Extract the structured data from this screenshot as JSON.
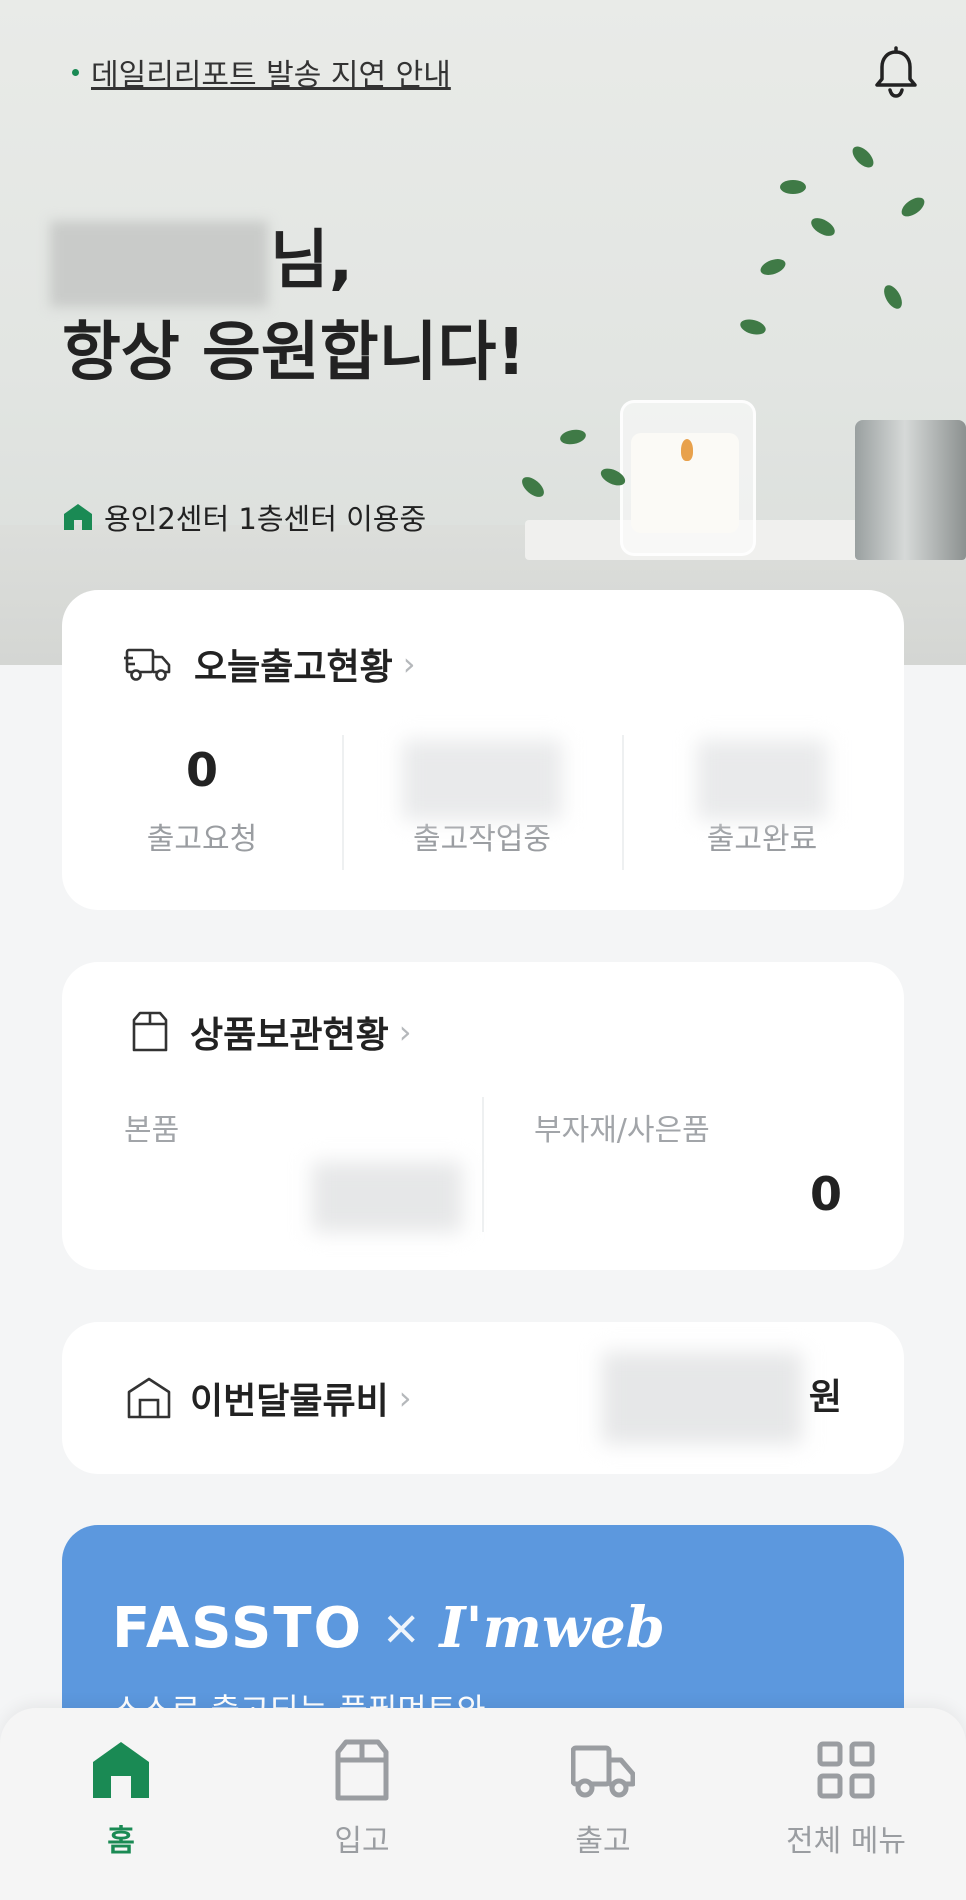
{
  "header": {
    "notice_text": "데일리리포트 발송 지연 안내",
    "greeting_suffix": "님,",
    "greeting_line2": "항상 응원합니다!",
    "center_status": "용인2센터 1층센터 이용중"
  },
  "outbound_card": {
    "title": "오늘출고현황",
    "stats": [
      {
        "label": "출고요청",
        "value": "0"
      },
      {
        "label": "출고작업중",
        "value": ""
      },
      {
        "label": "출고완료",
        "value": ""
      }
    ]
  },
  "storage_card": {
    "title": "상품보관현황",
    "main_label": "본품",
    "main_value": "",
    "sub_label": "부자재/사은품",
    "sub_value": "0"
  },
  "fee_card": {
    "title": "이번달물류비",
    "currency": "원"
  },
  "banner": {
    "brand_left": "FASSTO",
    "separator": "×",
    "brand_right": "I'mweb",
    "subtitle": "스스로 출고되는 풀필먼트와"
  },
  "bottom_nav": {
    "items": [
      {
        "label": "홈",
        "icon": "home-icon",
        "active": true
      },
      {
        "label": "입고",
        "icon": "box-icon",
        "active": false
      },
      {
        "label": "출고",
        "icon": "truck-icon",
        "active": false
      },
      {
        "label": "전체 메뉴",
        "icon": "grid-icon",
        "active": false
      }
    ]
  },
  "colors": {
    "accent": "#1a8a54",
    "banner": "#5c98de",
    "background": "#f4f5f6"
  }
}
